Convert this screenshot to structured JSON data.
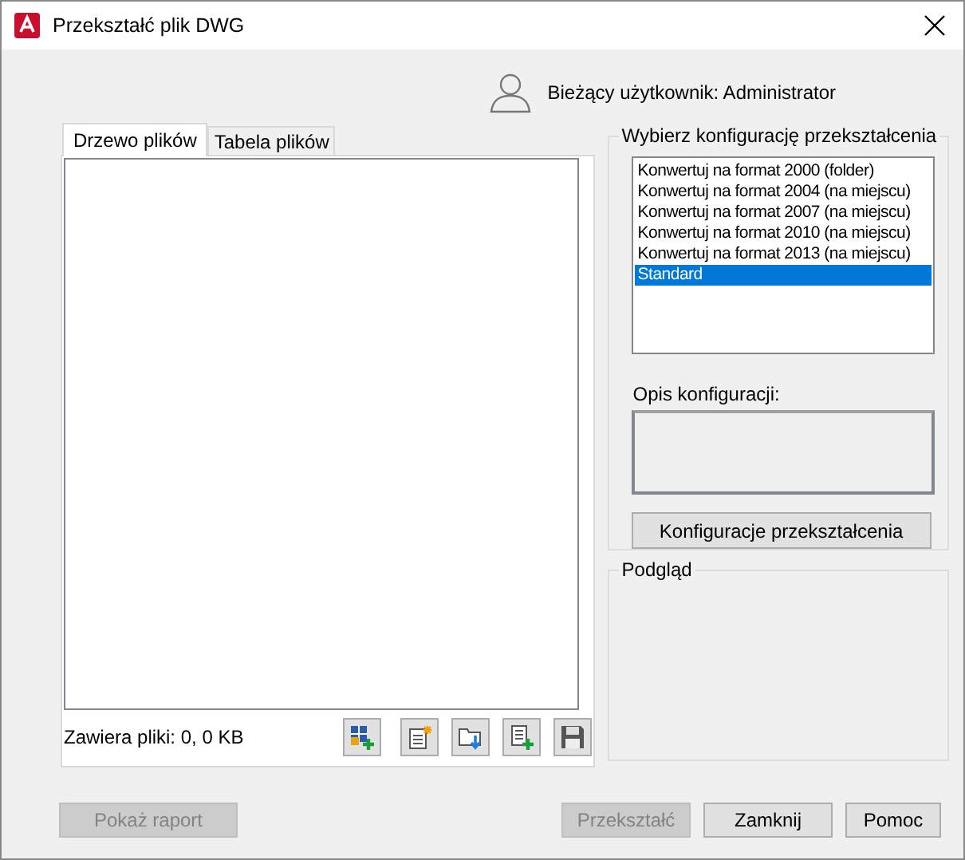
{
  "window": {
    "title": "Przekształć plik DWG"
  },
  "user": {
    "label": "Bieżący użytkownik: Administrator"
  },
  "tabs": [
    {
      "label": "Drzewo plików",
      "selected": true
    },
    {
      "label": "Tabela plików",
      "selected": false
    }
  ],
  "file_status": "Zawiera pliki: 0, 0 KB",
  "toolbar": [
    {
      "kind": "drawing-add"
    },
    {
      "kind": "new-list"
    },
    {
      "kind": "open-list"
    },
    {
      "kind": "append-list"
    },
    {
      "kind": "save"
    }
  ],
  "config_group": {
    "title": "Wybierz konfigurację przekształcenia",
    "items": [
      {
        "label": "Konwertuj na format 2000 (folder)",
        "selected": false
      },
      {
        "label": "Konwertuj na format 2004 (na miejscu)",
        "selected": false
      },
      {
        "label": "Konwertuj na format 2007 (na miejscu)",
        "selected": false
      },
      {
        "label": "Konwertuj na format 2010 (na miejscu)",
        "selected": false
      },
      {
        "label": "Konwertuj na format 2013 (na miejscu)",
        "selected": false
      },
      {
        "label": "Standard",
        "selected": true
      }
    ],
    "description_label": "Opis konfiguracji:",
    "button": "Konfiguracje przekształcenia"
  },
  "preview_group": {
    "title": "Podgląd"
  },
  "buttons": [
    {
      "label": "Pokaż raport",
      "disabled": true
    },
    {
      "label": "Przekształć",
      "disabled": true
    },
    {
      "label": "Zamknij",
      "disabled": false
    },
    {
      "label": "Pomoc",
      "disabled": false
    }
  ]
}
